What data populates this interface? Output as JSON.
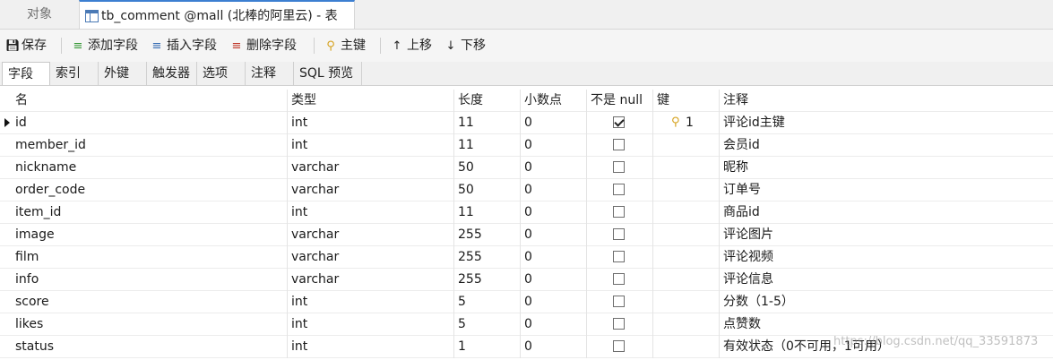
{
  "doc_tabs": {
    "objects_label": "对象",
    "active_label": "tb_comment @mall (北棒的阿里云) - 表"
  },
  "toolbar": {
    "save": "保存",
    "add_field": "添加字段",
    "insert_field": "插入字段",
    "delete_field": "删除字段",
    "primary_key": "主键",
    "move_up": "上移",
    "move_down": "下移"
  },
  "sub_tabs": [
    "字段",
    "索引",
    "外键",
    "触发器",
    "选项",
    "注释",
    "SQL 预览"
  ],
  "columns": [
    "名",
    "类型",
    "长度",
    "小数点",
    "不是 null",
    "键",
    "注释"
  ],
  "rows": [
    {
      "name": "id",
      "type": "int",
      "length": "11",
      "decimals": "0",
      "not_null": true,
      "key": "1",
      "comment": "评论id主键"
    },
    {
      "name": "member_id",
      "type": "int",
      "length": "11",
      "decimals": "0",
      "not_null": false,
      "key": "",
      "comment": "会员id"
    },
    {
      "name": "nickname",
      "type": "varchar",
      "length": "50",
      "decimals": "0",
      "not_null": false,
      "key": "",
      "comment": "昵称"
    },
    {
      "name": "order_code",
      "type": "varchar",
      "length": "50",
      "decimals": "0",
      "not_null": false,
      "key": "",
      "comment": "订单号"
    },
    {
      "name": "item_id",
      "type": "int",
      "length": "11",
      "decimals": "0",
      "not_null": false,
      "key": "",
      "comment": "商品id"
    },
    {
      "name": "image",
      "type": "varchar",
      "length": "255",
      "decimals": "0",
      "not_null": false,
      "key": "",
      "comment": "评论图片"
    },
    {
      "name": "film",
      "type": "varchar",
      "length": "255",
      "decimals": "0",
      "not_null": false,
      "key": "",
      "comment": "评论视频"
    },
    {
      "name": "info",
      "type": "varchar",
      "length": "255",
      "decimals": "0",
      "not_null": false,
      "key": "",
      "comment": "评论信息"
    },
    {
      "name": "score",
      "type": "int",
      "length": "5",
      "decimals": "0",
      "not_null": false,
      "key": "",
      "comment": "分数（1-5）"
    },
    {
      "name": "likes",
      "type": "int",
      "length": "5",
      "decimals": "0",
      "not_null": false,
      "key": "",
      "comment": "点赞数"
    },
    {
      "name": "status",
      "type": "int",
      "length": "1",
      "decimals": "0",
      "not_null": false,
      "key": "",
      "comment": "有效状态（0不可用，1可用）"
    }
  ],
  "watermark": "https://blog.csdn.net/qq_33591873",
  "colors": {
    "accent": "#3c7fd1",
    "key_icon": "#d6a21e"
  }
}
